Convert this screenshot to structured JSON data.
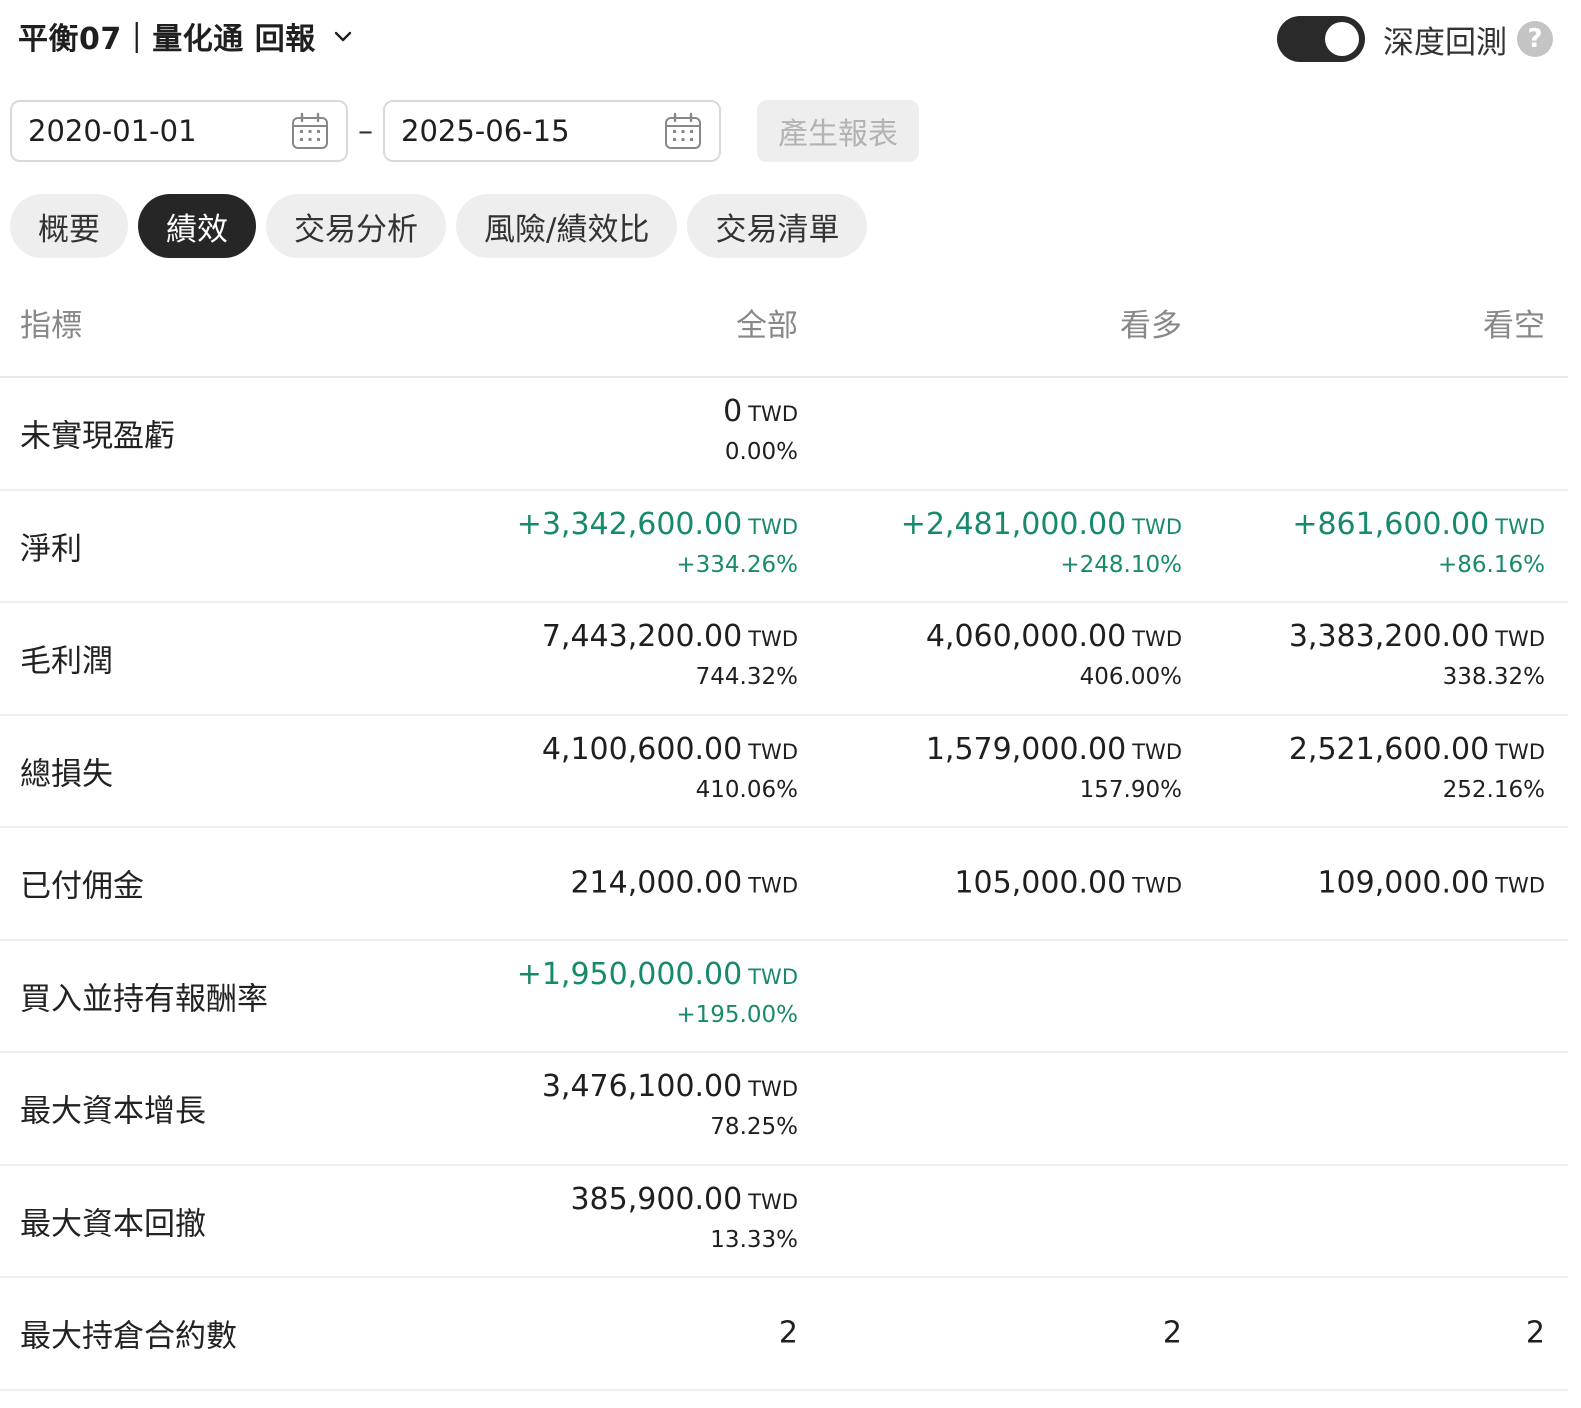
{
  "header": {
    "title": "平衡07｜量化通 回報",
    "deep_backtest_label": "深度回測",
    "help_glyph": "?"
  },
  "dates": {
    "start": "2020-01-01",
    "separator": "–",
    "end": "2025-06-15",
    "generate_label": "產生報表"
  },
  "tabs": [
    {
      "label": "概要",
      "active": false
    },
    {
      "label": "績效",
      "active": true
    },
    {
      "label": "交易分析",
      "active": false
    },
    {
      "label": "風險/績效比",
      "active": false
    },
    {
      "label": "交易清單",
      "active": false
    }
  ],
  "table": {
    "columns": [
      "指標",
      "全部",
      "看多",
      "看空"
    ],
    "currency": "TWD",
    "rows": [
      {
        "label": "未實現盈虧",
        "all": {
          "amt": "0",
          "pct": "0.00%"
        }
      },
      {
        "label": "淨利",
        "positive": true,
        "all": {
          "amt": "+3,342,600.00",
          "pct": "+334.26%"
        },
        "long": {
          "amt": "+2,481,000.00",
          "pct": "+248.10%"
        },
        "short": {
          "amt": "+861,600.00",
          "pct": "+86.16%"
        }
      },
      {
        "label": "毛利潤",
        "all": {
          "amt": "7,443,200.00",
          "pct": "744.32%"
        },
        "long": {
          "amt": "4,060,000.00",
          "pct": "406.00%"
        },
        "short": {
          "amt": "3,383,200.00",
          "pct": "338.32%"
        }
      },
      {
        "label": "總損失",
        "all": {
          "amt": "4,100,600.00",
          "pct": "410.06%"
        },
        "long": {
          "amt": "1,579,000.00",
          "pct": "157.90%"
        },
        "short": {
          "amt": "2,521,600.00",
          "pct": "252.16%"
        }
      },
      {
        "label": "已付佣金",
        "all": {
          "amt": "214,000.00"
        },
        "long": {
          "amt": "105,000.00"
        },
        "short": {
          "amt": "109,000.00"
        }
      },
      {
        "label": "買入並持有報酬率",
        "positive": true,
        "all": {
          "amt": "+1,950,000.00",
          "pct": "+195.00%"
        }
      },
      {
        "label": "最大資本增長",
        "all": {
          "amt": "3,476,100.00",
          "pct": "78.25%"
        }
      },
      {
        "label": "最大資本回撤",
        "all": {
          "amt": "385,900.00",
          "pct": "13.33%"
        }
      },
      {
        "label": "最大持倉合約數",
        "all": {
          "num": "2"
        },
        "long": {
          "num": "2"
        },
        "short": {
          "num": "2"
        }
      }
    ]
  },
  "colors": {
    "positive": "#178a6e",
    "active_tab": "#262626"
  }
}
